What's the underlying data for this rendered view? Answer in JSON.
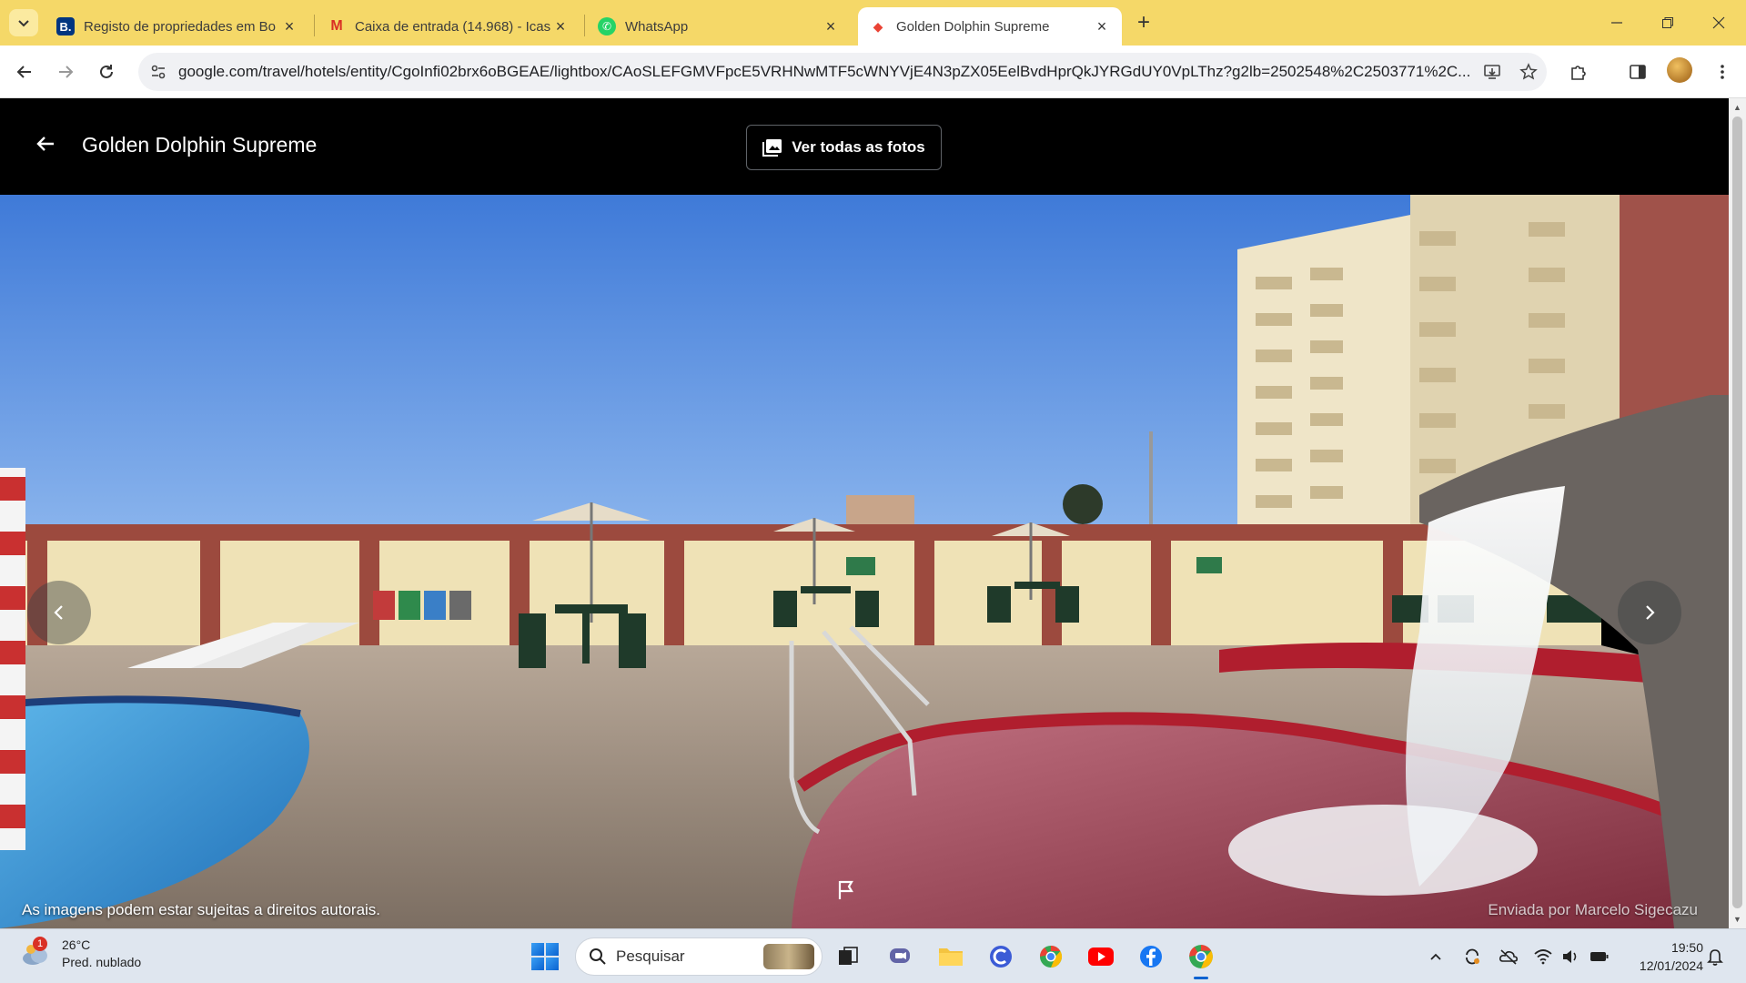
{
  "browser": {
    "tabs": [
      {
        "title": "Registo de propriedades em Bo",
        "favicon": "booking-icon",
        "favicon_text": "B.",
        "favicon_color": "#003580",
        "active": false
      },
      {
        "title": "Caixa de entrada (14.968) - Icas",
        "favicon": "gmail-icon",
        "favicon_text": "M",
        "favicon_color": "#d93025",
        "active": false
      },
      {
        "title": "WhatsApp",
        "favicon": "whatsapp-icon",
        "favicon_text": "✆",
        "favicon_color": "#25d366",
        "active": false
      },
      {
        "title": "Golden Dolphin Supreme",
        "favicon": "google-hotels-icon",
        "favicon_text": "◆",
        "favicon_color": "#ea4335",
        "active": true
      }
    ],
    "url": "google.com/travel/hotels/entity/CgoInfi02brx6oBGEAE/lightbox/CAoSLEFGMVFpcE5VRHNwMTF5cWNYVjE4N3pZX05EelBvdHprQkJYRGdUY0VpLThz?g2lb=2502548%2C2503771%2C..."
  },
  "lightbox": {
    "title": "Golden Dolphin Supreme",
    "all_photos_label": "Ver todas as fotos",
    "copyright_notice": "As imagens podem estar sujeitas a direitos autorais.",
    "uploader": "Enviada por Marcelo Sigecazu"
  },
  "taskbar": {
    "weather_temp": "26°C",
    "weather_desc": "Pred. nublado",
    "weather_badge": "1",
    "search_placeholder": "Pesquisar",
    "time": "19:50",
    "date": "12/01/2024"
  },
  "colors": {
    "tabstrip": "#f5d868",
    "accent": "#0a62d0"
  }
}
